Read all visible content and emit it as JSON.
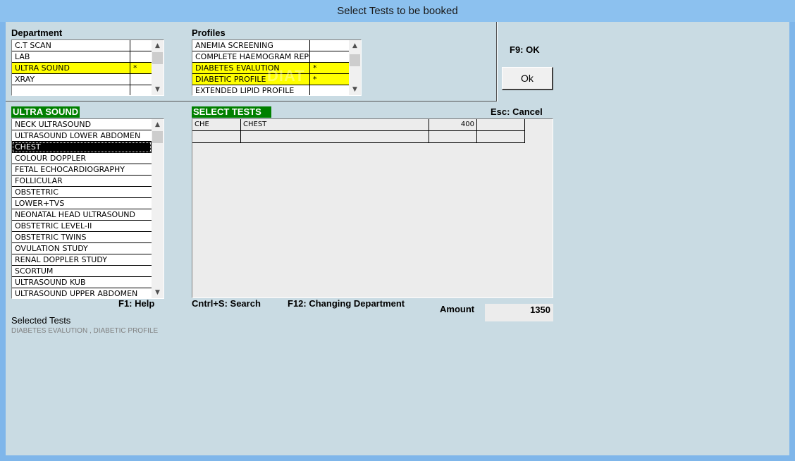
{
  "window": {
    "title": "Select Tests to be booked"
  },
  "department": {
    "header": "Department",
    "items": [
      {
        "name": "C.T SCAN",
        "mark": ""
      },
      {
        "name": "LAB",
        "mark": ""
      },
      {
        "name": "ULTRA SOUND",
        "mark": "*",
        "highlight": "yellow"
      },
      {
        "name": "XRAY",
        "mark": ""
      },
      {
        "name": "",
        "mark": ""
      }
    ]
  },
  "profiles": {
    "header": "Profiles",
    "items": [
      {
        "name": "ANEMIA SCREENING",
        "mark": ""
      },
      {
        "name": "COMPLETE HAEMOGRAM REPORT",
        "mark": ""
      },
      {
        "name": "DIABETES EVALUTION",
        "mark": "*",
        "highlight": "yellow"
      },
      {
        "name": "DIABETIC PROFILE",
        "mark": "*",
        "highlight": "yellow"
      },
      {
        "name": "EXTENDED LIPID PROFILE",
        "mark": ""
      }
    ],
    "watermark": "DIAT"
  },
  "shortcuts": {
    "f9": "F9: OK",
    "esc": "Esc: Cancel",
    "f1": "F1: Help",
    "search": "Cntrl+S: Search",
    "f12": "F12: Changing Department"
  },
  "ok_button": "Ok",
  "tests_list": {
    "header": "ULTRA SOUND",
    "items": [
      "NECK  ULTRASOUND",
      "ULTRASOUND LOWER ABDOMEN",
      "CHEST",
      "COLOUR DOPPLER",
      "FETAL ECHOCARDIOGRAPHY",
      "FOLLICULAR",
      "OBSTETRIC",
      "LOWER+TVS",
      "NEONATAL HEAD ULTRASOUND",
      "OBSTETRIC LEVEL-II",
      "OBSTETRIC TWINS",
      "OVULATION STUDY",
      "RENAL DOPPLER STUDY",
      "SCORTUM",
      "ULTRASOUND KUB",
      "ULTRASOUND UPPER ABDOMEN"
    ],
    "selected": "CHEST"
  },
  "select_tests": {
    "header": "SELECT TESTS",
    "rows": [
      {
        "code": "CHE",
        "name": "CHEST",
        "price": "400",
        "extra": ""
      },
      {
        "code": "",
        "name": "",
        "price": "",
        "extra": ""
      }
    ]
  },
  "amount": {
    "label": "Amount",
    "value": "1350"
  },
  "selected_tests": {
    "label": "Selected Tests",
    "value": "DIABETES EVALUTION , DIABETIC PROFILE"
  },
  "colors": {
    "highlight": "#ffff00",
    "header_green": "#008000",
    "window_bg": "#c9dbe3"
  }
}
